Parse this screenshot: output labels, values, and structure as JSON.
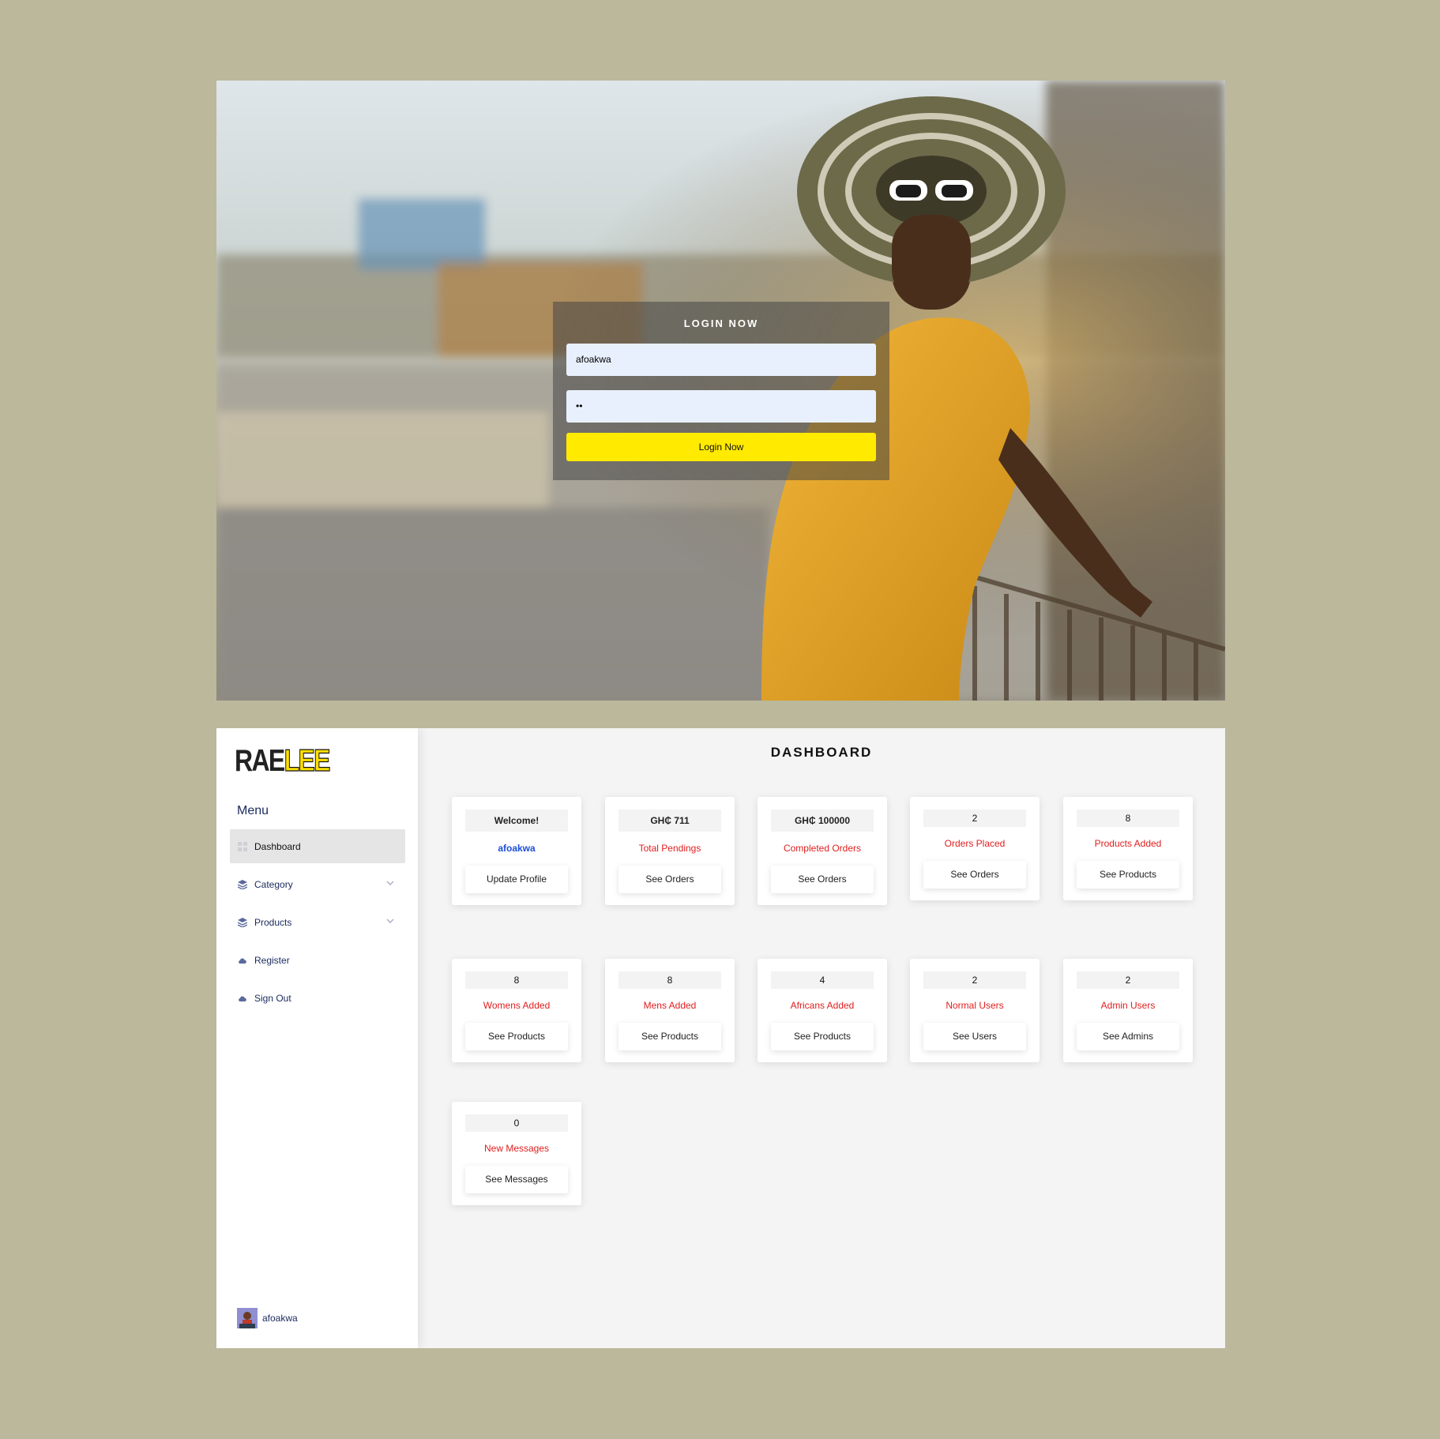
{
  "login": {
    "title": "LOGIN NOW",
    "username_value": "afoakwa",
    "password_value": "••",
    "button_label": "Login Now"
  },
  "dashboard": {
    "logo_part1": "RAE",
    "logo_part2": "LEE",
    "menu_heading": "Menu",
    "page_title": "DASHBOARD",
    "nav": [
      {
        "label": "Dashboard",
        "icon": "grid-icon",
        "active": true
      },
      {
        "label": "Category",
        "icon": "layers-icon",
        "expandable": true
      },
      {
        "label": "Products",
        "icon": "layers-icon",
        "expandable": true
      },
      {
        "label": "Register",
        "icon": "cloud-icon"
      },
      {
        "label": "Sign Out",
        "icon": "cloud-icon"
      }
    ],
    "user": {
      "name": "afoakwa"
    },
    "cards": [
      {
        "value": "Welcome!",
        "label": "afoakwa",
        "button": "Update Profile"
      },
      {
        "value": "GH₵ 711",
        "label": "Total Pendings",
        "button": "See Orders"
      },
      {
        "value": "GH₵ 100000",
        "label": "Completed Orders",
        "button": "See Orders"
      },
      {
        "value": "2",
        "label": "Orders Placed",
        "button": "See Orders"
      },
      {
        "value": "8",
        "label": "Products Added",
        "button": "See Products"
      },
      {
        "value": "8",
        "label": "Womens Added",
        "button": "See Products"
      },
      {
        "value": "8",
        "label": "Mens Added",
        "button": "See Products"
      },
      {
        "value": "4",
        "label": "Africans Added",
        "button": "See Products"
      },
      {
        "value": "2",
        "label": "Normal Users",
        "button": "See Users"
      },
      {
        "value": "2",
        "label": "Admin Users",
        "button": "See Admins"
      },
      {
        "value": "0",
        "label": "New Messages",
        "button": "See Messages"
      }
    ]
  },
  "colors": {
    "backdrop": "#bbb89c",
    "accent_yellow": "#ffea00",
    "label_red": "#e11d1d",
    "link_blue": "#1c4fd8",
    "nav_text": "#1a2a5e"
  }
}
